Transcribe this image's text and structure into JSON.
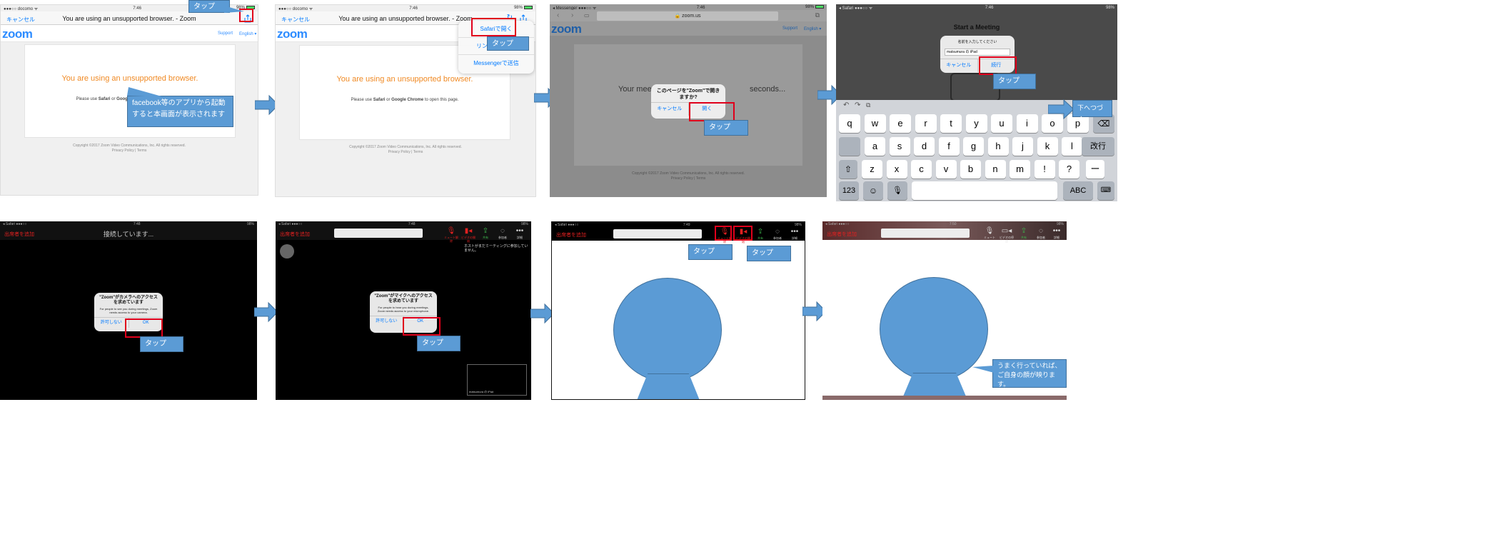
{
  "panel1": {
    "status_left": "●●●○○ docomo ᯤ",
    "time": "7:46",
    "battery": "98%",
    "cancel": "キャンセル",
    "title": "You are using an unsupported browser. - Zoom",
    "logo": "zoom",
    "support": "Support",
    "language": "English ▾",
    "heading": "You are using an unsupported browser.",
    "message_prefix": "Please use ",
    "message_safari": "Safari",
    "message_or": " or ",
    "message_chrome": "Google Chrome",
    "message_suffix": " to open this page.",
    "copyright": "Copyright ©2017 Zoom Video Communications, Inc. All rights reserved.",
    "policy": "Privacy Policy | Terms",
    "callout_tap": "タップ",
    "callout_note": "facebook等のアプリから起動すると本画面が表示されます"
  },
  "panel2": {
    "status_left": "●●●○○ docomo ᯤ",
    "time": "7:46",
    "battery": "98%",
    "cancel": "キャンセル",
    "title": "You are using an unsupported browser. - Zoom",
    "logo": "zoom",
    "heading": "You are using an unsupported browser.",
    "menu_items": [
      "Safariで開く",
      "リンクをコピー",
      "Messengerで送信"
    ],
    "callout_tap": "タップ"
  },
  "panel3": {
    "status_left": "◂ Messenger ●●●○○ ᯤ",
    "time": "7:46",
    "battery": "98%",
    "url": "🔒 zoom.us",
    "logo": "zoom",
    "support": "Support",
    "language": "English ▾",
    "bg_text_left": "Your meet",
    "bg_text_right": "seconds...",
    "dialog_title": "このページを\"Zoom\"で開きますか?",
    "cancel": "キャンセル",
    "open": "開く",
    "callout_tap": "タップ",
    "copyright": "Copyright ©2017 Zoom Video Communications, Inc. All rights reserved.",
    "policy": "Privacy Policy | Terms"
  },
  "panel4": {
    "title": "Start a Meeting",
    "dialog_title": "名前を入力してください",
    "name_value": "matsumura の iPad",
    "cancel": "キャンセル",
    "continue": "続行",
    "callout_tap": "タップ",
    "callout_next": "下へつづく",
    "row1": [
      "q",
      "w",
      "e",
      "r",
      "t",
      "y",
      "u",
      "i",
      "o",
      "p"
    ],
    "row2": [
      "a",
      "s",
      "d",
      "f",
      "g",
      "h",
      "j",
      "k",
      "l"
    ],
    "return_key": "改行",
    "row3": [
      "z",
      "x",
      "c",
      "v",
      "b",
      "n",
      "m",
      "!",
      "?"
    ],
    "row3_sub": [
      ",",
      "."
    ],
    "dash": "ー",
    "num_key": "123",
    "abc_key": "ABC"
  },
  "panel5": {
    "invite": "出席者を追加",
    "connecting": "接続しています...",
    "dialog_title": "\"Zoom\"がカメラへのアクセスを求めています",
    "dialog_body": "For people to see you during meetings, Zoom needs access to your camera.",
    "deny": "許可しない",
    "ok": "OK",
    "callout_tap": "タップ"
  },
  "panel6": {
    "invite": "出席者を追加",
    "waiting": "ホストがまだミーティングに参加していません。",
    "dialog_title": "\"Zoom\"がマイクへのアクセスを求めています",
    "dialog_body": "For people to hear you during meetings, Zoom needs access to your microphone.",
    "deny": "許可しない",
    "ok": "OK",
    "callout_tap": "タップ",
    "self_label": "matsumura の iPad",
    "tools": [
      "ミュート解除",
      "ビデオの開始",
      "共有",
      "参加者",
      "詳細"
    ]
  },
  "panel7": {
    "invite": "出席者を追加",
    "tools": [
      "ミュート解除",
      "ビデオの開始",
      "共有",
      "参加者",
      "詳細"
    ],
    "callout_tap_mic": "タップ",
    "callout_tap_video": "タップ"
  },
  "panel8": {
    "invite": "出席者を追加",
    "time": "7:50",
    "tools": [
      "ミュート",
      "ビデオの停止",
      "共有",
      "参加者",
      "詳細"
    ],
    "callout_success": "うまく行っていれば、ご自身の顔が映ります。"
  },
  "colors": {
    "callout": "#5b9bd5",
    "highlight": "#e0001b",
    "zoom_blue": "#2d8cff",
    "warning_orange": "#f08a24"
  }
}
